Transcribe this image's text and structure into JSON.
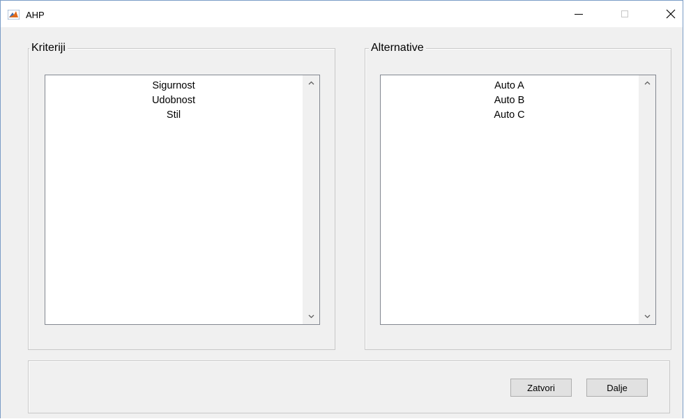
{
  "window": {
    "title": "AHP",
    "controls": {
      "minimize": "minimize-icon",
      "maximize": "maximize-icon",
      "close": "close-icon"
    }
  },
  "kriteriji": {
    "title": "Kriteriji",
    "items": [
      "Sigurnost",
      "Udobnost",
      "Stil"
    ]
  },
  "alternative": {
    "title": "Alternative",
    "items": [
      "Auto A",
      "Auto B",
      "Auto C"
    ]
  },
  "buttons": {
    "close_label": "Zatvori",
    "next_label": "Dalje"
  },
  "colors": {
    "window_bg": "#f0f0f0",
    "titlebar_bg": "#ffffff",
    "window_border": "#7a9cc6",
    "listbox_border": "#828790",
    "button_bg": "#e1e1e1"
  }
}
